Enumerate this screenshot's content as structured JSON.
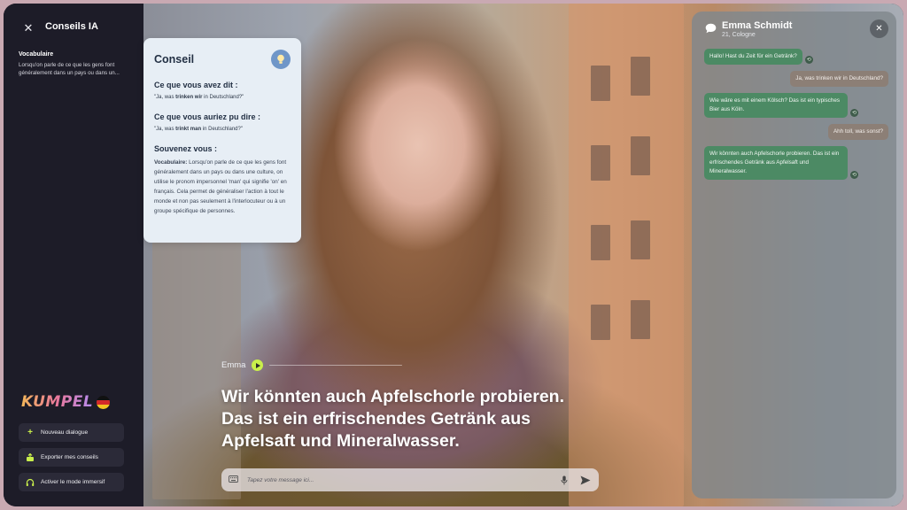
{
  "sidebar": {
    "title": "Conseils IA",
    "section_title": "Vocabulaire",
    "section_text": "Lorsqu'on parle de ce que les gens font généralement dans un pays ou dans un...",
    "logo_text": "KUMPEL",
    "buttons": [
      {
        "label": "Nouveau dialogue",
        "icon": "plus-icon"
      },
      {
        "label": "Exporter mes conseils",
        "icon": "export-icon"
      },
      {
        "label": "Activer le mode immersif",
        "icon": "headphones-icon"
      }
    ]
  },
  "tip": {
    "title": "Conseil",
    "said_heading": "Ce que vous avez dit :",
    "said_pre": "\"Ja, was ",
    "said_bold": "trinken wir",
    "said_post": " in Deutschland?\"",
    "could_heading": "Ce que vous auriez pu dire :",
    "could_pre": "\"Ja, was ",
    "could_bold": "trinkt man",
    "could_post": " in Deutschland?\"",
    "remember_heading": "Souvenez vous :",
    "remember_label": "Vocabulaire:",
    "remember_text": " Lorsqu'on parle de ce que les gens font généralement dans un pays ou dans une culture, on utilise le pronom impersonnel 'man' qui signifie 'on' en français. Cela permet de généraliser l'action à tout le monde et non pas seulement à l'interlocuteur ou à un groupe spécifique de personnes."
  },
  "subtitle": {
    "speaker": "Emma",
    "lines": [
      "Wir könnten auch Apfelschorle probieren.",
      "Das ist ein erfrischendes Getränk aus",
      "Apfelsaft und Mineralwasser."
    ]
  },
  "input": {
    "placeholder": "Tapez votre message ici..."
  },
  "chat": {
    "name": "Emma Schmidt",
    "subtitle": "21, Cologne",
    "messages": [
      {
        "from": "in",
        "text": "Hallo! Hast du Zeit für ein Getränk?"
      },
      {
        "from": "out",
        "text": "Ja, was trinken wir in Deutschland?"
      },
      {
        "from": "in",
        "text": "Wie wäre es mit einem Kölsch? Das ist ein typisches Bier aus Köln."
      },
      {
        "from": "out",
        "text": "Ahh toll, was sonst?"
      },
      {
        "from": "in",
        "text": "Wir könnten auch Apfelschorle probieren. Das ist ein erfrischendes Getränk aus Apfelsaft und Mineralwasser."
      }
    ]
  },
  "colors": {
    "sidebar_bg": "#1d1c28",
    "accent_play": "#c9ef4b",
    "bubble_in": "#4c8a64",
    "bubble_out": "#8c7f76",
    "tip_bg": "#e7eef5"
  }
}
